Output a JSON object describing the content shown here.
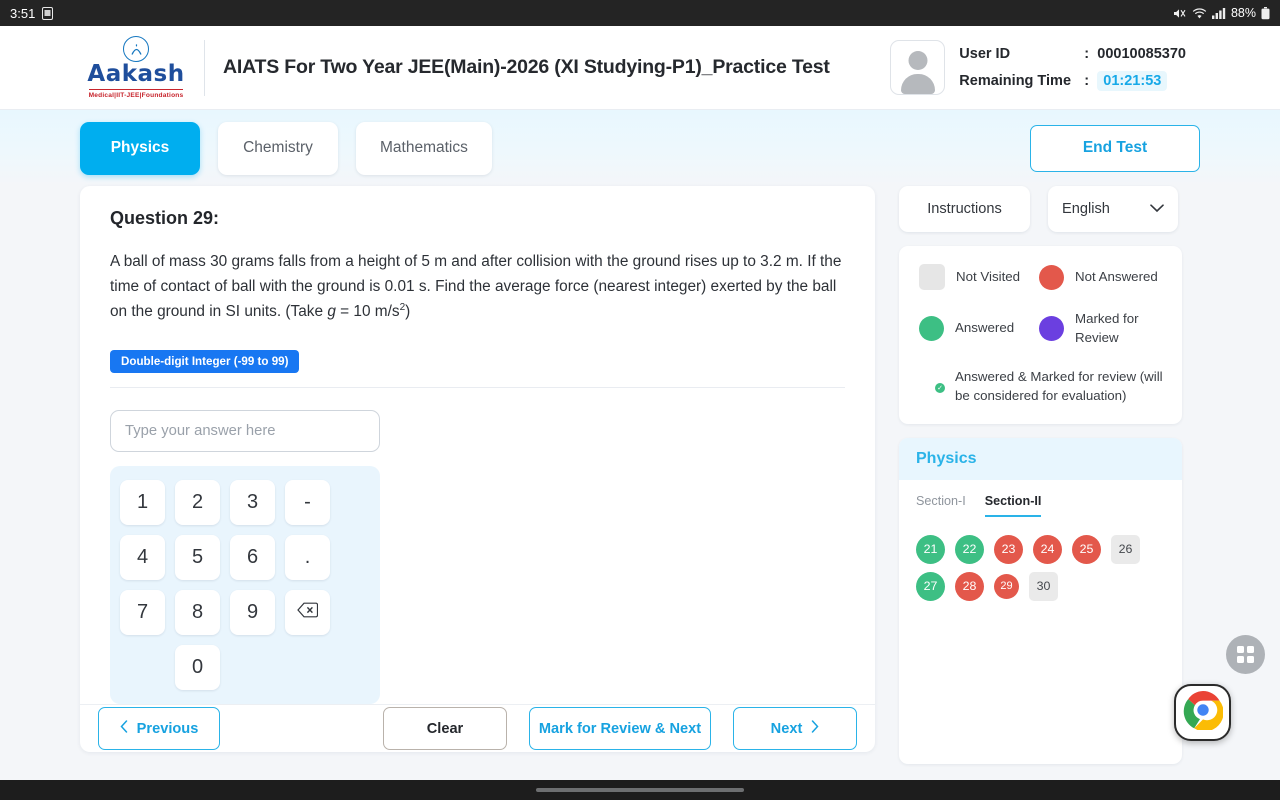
{
  "statusbar": {
    "time": "3:51",
    "battery": "88%",
    "icons": [
      "screenshot-icon",
      "volume-mute-icon",
      "wifi-icon",
      "signal-icon",
      "battery-icon"
    ]
  },
  "header": {
    "logo_name": "Aakash",
    "logo_tagline": "Medical|IIT-JEE|Foundations",
    "test_title": "AIATS For Two Year JEE(Main)-2026 (XI Studying-P1)_Practice Test",
    "user_id_label": "User ID",
    "user_id_value": "00010085370",
    "remaining_time_label": "Remaining Time",
    "remaining_time_value": "01:21:53",
    "colon": ":"
  },
  "tabs": {
    "subjects": [
      {
        "label": "Physics",
        "active": true
      },
      {
        "label": "Chemistry",
        "active": false
      },
      {
        "label": "Mathematics",
        "active": false
      }
    ],
    "end_test_label": "End Test"
  },
  "question": {
    "title": "Question 29:",
    "text_part1": "A ball of mass 30 grams falls from a height of 5 m and after collision with the ground rises up to 3.2 m. If the time of contact of ball with the ground is 0.01 s. Find the average force (nearest integer) exerted by the ball on the ground in SI units. (Take ",
    "text_italic": "g",
    "text_part2": " = 10 m/s",
    "text_sup": "2",
    "text_part3": ")",
    "type_badge": "Double-digit Integer (-99 to 99)",
    "answer_value": "",
    "answer_placeholder": "Type your answer here",
    "keypad_rows": [
      [
        "1",
        "2",
        "3",
        "-"
      ],
      [
        "4",
        "5",
        "6",
        "."
      ],
      [
        "7",
        "8",
        "9",
        "backspace-icon"
      ],
      [
        "",
        "0",
        "",
        ""
      ]
    ]
  },
  "footer": {
    "previous_label": "Previous",
    "clear_label": "Clear",
    "mark_review_label": "Mark for Review & Next",
    "next_label": "Next"
  },
  "rightpanel": {
    "instructions_label": "Instructions",
    "language_value": "English",
    "legend": [
      {
        "label": "Not Visited",
        "style": "square",
        "color": "#e6e6e6"
      },
      {
        "label": "Not Answered",
        "style": "circle",
        "color": "#e3584b"
      },
      {
        "label": "Answered",
        "style": "circle",
        "color": "#3dbf84"
      },
      {
        "label": "Marked for Review",
        "style": "circle",
        "color": "#6b3fe0"
      },
      {
        "label": "Answered & Marked for review (will be considered for evaluation)",
        "style": "circle-badge",
        "color": "#6b3fe0"
      }
    ],
    "palette_subject": "Physics",
    "sections": [
      {
        "label": "Section-I",
        "active": false
      },
      {
        "label": "Section-II",
        "active": true
      }
    ],
    "questions": [
      {
        "num": "21",
        "state": "answered"
      },
      {
        "num": "22",
        "state": "answered"
      },
      {
        "num": "23",
        "state": "notanswered"
      },
      {
        "num": "24",
        "state": "notanswered"
      },
      {
        "num": "25",
        "state": "notanswered"
      },
      {
        "num": "26",
        "state": "notvisited"
      },
      {
        "num": "27",
        "state": "answered"
      },
      {
        "num": "28",
        "state": "notanswered"
      },
      {
        "num": "29",
        "state": "notanswered current"
      },
      {
        "num": "30",
        "state": "notvisited"
      }
    ]
  },
  "floating": {
    "apps_button": "apps-grid-icon",
    "chrome_bubble": "chrome-icon"
  },
  "colors": {
    "accent_cyan": "#00aeef",
    "badge_blue": "#1877f2",
    "answered_green": "#3dbf84",
    "not_answered_red": "#e3584b",
    "review_purple": "#6b3fe0",
    "not_visited_gray": "#e6e6e6",
    "page_bg": "#f4f6f9"
  }
}
